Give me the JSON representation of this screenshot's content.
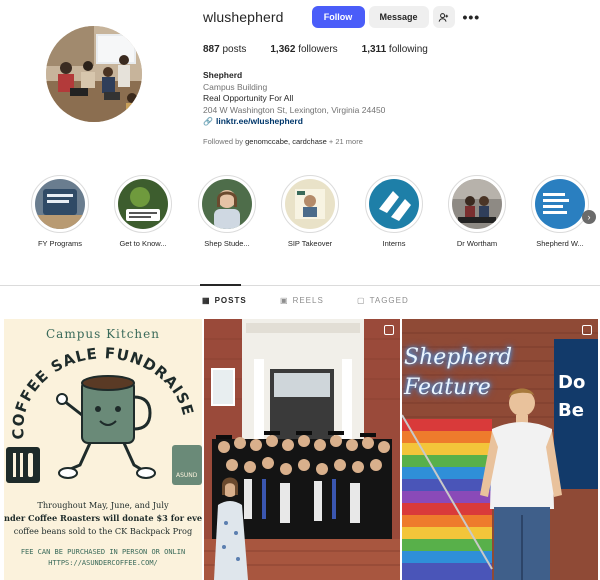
{
  "profile": {
    "username": "wlushepherd",
    "follow_label": "Follow",
    "message_label": "Message",
    "posts_count": "887",
    "posts_label": "posts",
    "followers_count": "1,362",
    "followers_label": "followers",
    "following_count": "1,311",
    "following_label": "following",
    "name": "Shepherd",
    "category": "Campus Building",
    "bio_line": "Real Opportunity For All",
    "address": "204 W Washington St, Lexington, Virginia 24450",
    "link": "linktr.ee/wlushepherd",
    "followed_by_prefix": "Followed by ",
    "followed_by_names": "genomccabe, cardchase",
    "followed_by_suffix": " + 21 more"
  },
  "icons": {
    "add_person": "person-add-icon",
    "more": "more-options-icon",
    "link": "link-icon",
    "posts_tab": "grid-icon",
    "reels_tab": "reels-icon",
    "tagged_tab": "tagged-icon",
    "next": "chevron-right-icon"
  },
  "highlights": [
    {
      "label": "FY Programs"
    },
    {
      "label": "Get to Know..."
    },
    {
      "label": "Shep Stude..."
    },
    {
      "label": "SIP Takeover"
    },
    {
      "label": "Interns"
    },
    {
      "label": "Dr Wortham"
    },
    {
      "label": "Shepherd W..."
    }
  ],
  "tabs": [
    {
      "label": "POSTS",
      "active": true
    },
    {
      "label": "REELS",
      "active": false
    },
    {
      "label": "TAGGED",
      "active": false
    }
  ],
  "posts": {
    "p1": {
      "title": "Campus Kitchen",
      "headline": "COFFEE SALE FUNDRAISER",
      "body_line1": "Throughout May, June, and July",
      "body_line2": "nder Coffee Roasters will donate $3 for eve",
      "body_line3": "coffee beans sold to the CK Backpack Prog",
      "foot_line1": "FEE CAN BE PURCHASED IN PERSON OR ONLIN",
      "foot_line2": "HTTPS://ASUNDERCOFFEE.COM/",
      "sign_text": "ASUND"
    },
    "p3": {
      "neon_line1": "Shepherd",
      "neon_line2": "Feature",
      "banner_text": "Do Be"
    }
  },
  "colors": {
    "follow_button": "#4a5df9",
    "link": "#00376b",
    "kitchen_green": "#3a6a5a"
  }
}
